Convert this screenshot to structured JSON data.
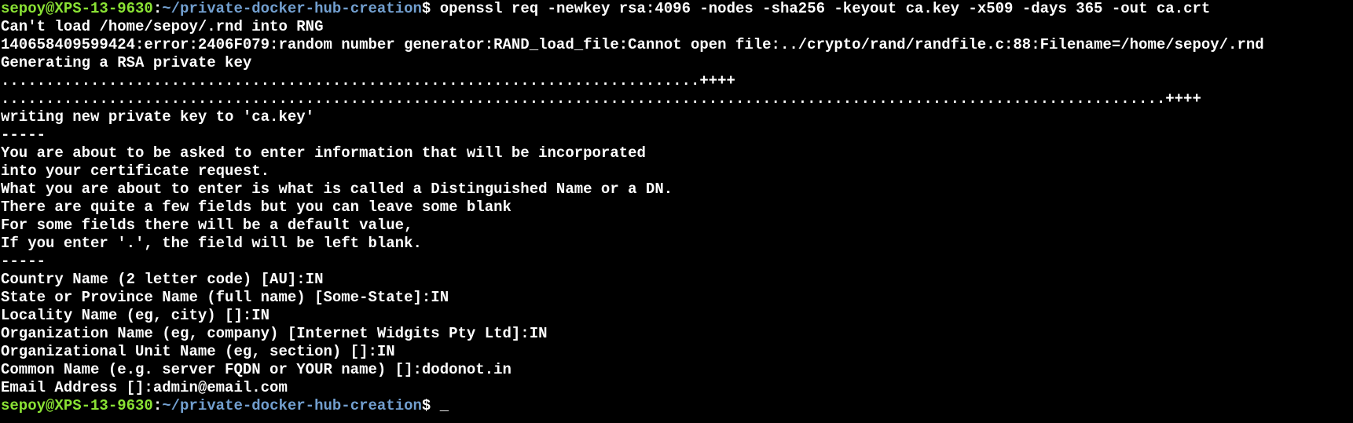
{
  "theme": {
    "background": "#000000",
    "foreground": "#ffffff",
    "prompt_user_color": "#8ae234",
    "prompt_path_color": "#729fcf"
  },
  "prompt": {
    "user_host": "sepoy@XPS-13-9630",
    "separator": ":",
    "path": "~/private-docker-hub-creation",
    "symbol": "$ "
  },
  "command": "openssl req -newkey rsa:4096 -nodes -sha256 -keyout ca.key -x509 -days 365 -out ca.crt",
  "output_lines": [
    "Can't load /home/sepoy/.rnd into RNG",
    "140658409599424:error:2406F079:random number generator:RAND_load_file:Cannot open file:../crypto/rand/randfile.c:88:Filename=/home/sepoy/.rnd",
    "Generating a RSA private key",
    "..............................................................................++++",
    "..................................................................................................................................++++",
    "writing new private key to 'ca.key'",
    "-----",
    "You are about to be asked to enter information that will be incorporated",
    "into your certificate request.",
    "What you are about to enter is what is called a Distinguished Name or a DN.",
    "There are quite a few fields but you can leave some blank",
    "For some fields there will be a default value,",
    "If you enter '.', the field will be left blank.",
    "-----",
    "Country Name (2 letter code) [AU]:IN",
    "State or Province Name (full name) [Some-State]:IN",
    "Locality Name (eg, city) []:IN",
    "Organization Name (eg, company) [Internet Widgits Pty Ltd]:IN",
    "Organizational Unit Name (eg, section) []:IN",
    "Common Name (e.g. server FQDN or YOUR name) []:dodonot.in",
    "Email Address []:admin@email.com"
  ],
  "cursor": "_"
}
